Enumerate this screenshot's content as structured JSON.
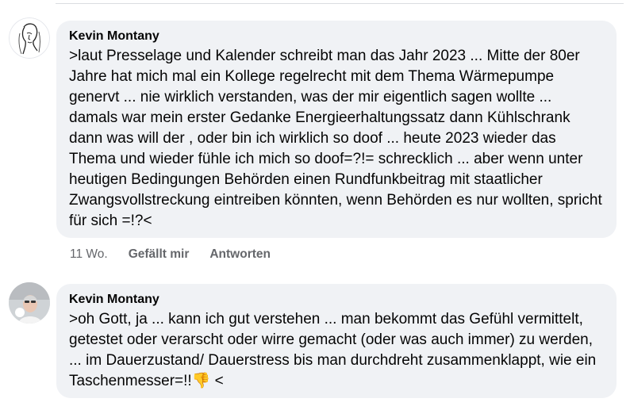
{
  "comments": [
    {
      "author": "Kevin Montany",
      "text": ">laut Presselage und Kalender schreibt man das Jahr 2023 ... Mitte der 80er Jahre hat mich mal ein Kollege regelrecht mit dem Thema Wärmepumpe genervt ... nie wirklich verstanden, was der mir eigentlich sagen wollte ... damals war mein erster Gedanke Energieerhaltungssatz dann Kühlschrank dann was will der , oder bin ich wirklich so doof ... heute 2023 wieder das Thema und wieder fühle ich mich so doof=?!= schrecklich ... aber wenn unter heutigen Bedingungen Behörden einen Rundfunkbeitrag mit staatlicher Zwangsvollstreckung eintreiben könnten, wenn Behörden es nur wollten, spricht für sich =!?<",
      "time": "11 Wo.",
      "like_label": "Gefällt mir",
      "reply_label": "Antworten",
      "avatar_icon": "sketch-portrait-avatar"
    },
    {
      "author": "Kevin Montany",
      "text_before_emoji": ">oh Gott, ja ... kann ich gut verstehen ... man bekommt das Gefühl vermittelt, getestet oder verarscht oder wirre  gemacht (oder was auch immer) zu werden, ... im Dauerzustand/ Dauerstress bis man durchdreht zusammenklappt, wie ein Taschenmesser=!!",
      "emoji": "👎",
      "text_after_emoji": " <",
      "avatar_icon": "photo-avatar"
    }
  ],
  "colors": {
    "bubble": "#f0f2f5",
    "secondary_text": "#65676b",
    "primary_text": "#050505"
  }
}
